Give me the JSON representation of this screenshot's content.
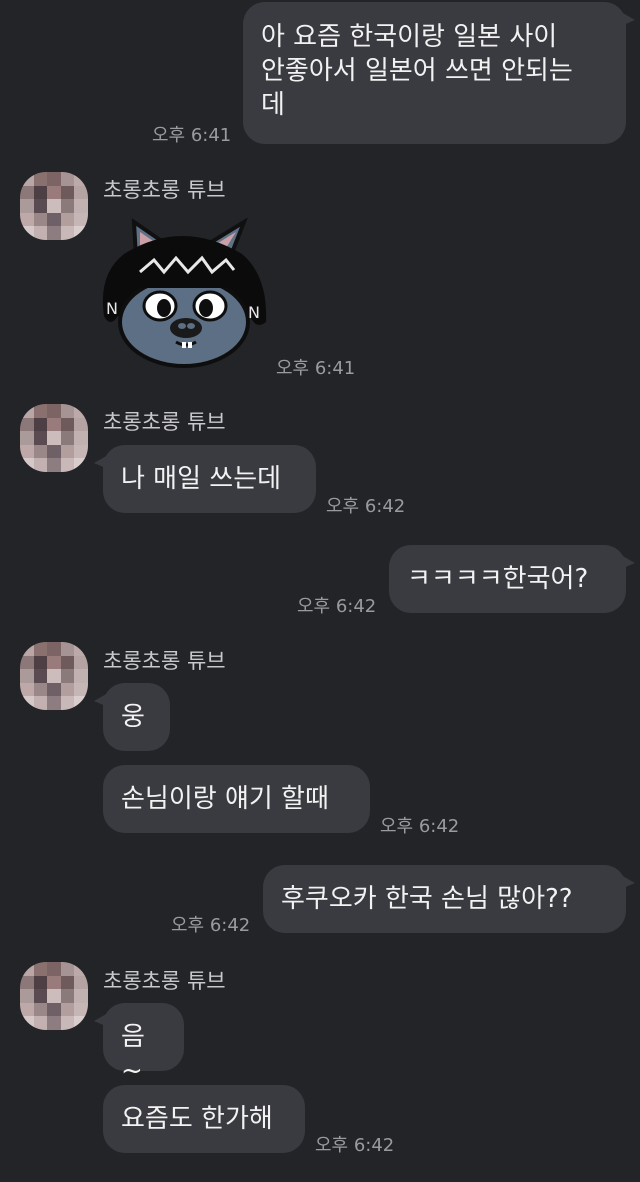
{
  "messages": {
    "m1": {
      "text": "아 요즘 한국이랑 일본 사이\n안좋아서 일본어 쓰면 안되는\n데",
      "time": "오후 6:41"
    },
    "group1": {
      "name": "초롱초롱 튜브",
      "sticker_time": "오후 6:41",
      "sticker": "cat-character-sticker"
    },
    "group2": {
      "name": "초롱초롱 튜브",
      "text": "나 매일 쓰는데",
      "time": "오후 6:42"
    },
    "m3": {
      "text": "ㅋㅋㅋㅋ한국어?",
      "time": "오후 6:42"
    },
    "group3": {
      "name": "초롱초롱 튜브",
      "text1": "웅",
      "text2": "손님이랑 얘기 할때",
      "time": "오후 6:42"
    },
    "m4": {
      "text": "후쿠오카 한국 손님 많아??",
      "time": "오후 6:42"
    },
    "group4": {
      "name": "초롱초롱 튜브",
      "text1": "음~",
      "text2": "요즘도 한가해",
      "time": "오후 6:42"
    }
  },
  "colors": {
    "background": "#232428",
    "bubble": "#3a3b40",
    "timestamp": "#9a9ba0"
  }
}
